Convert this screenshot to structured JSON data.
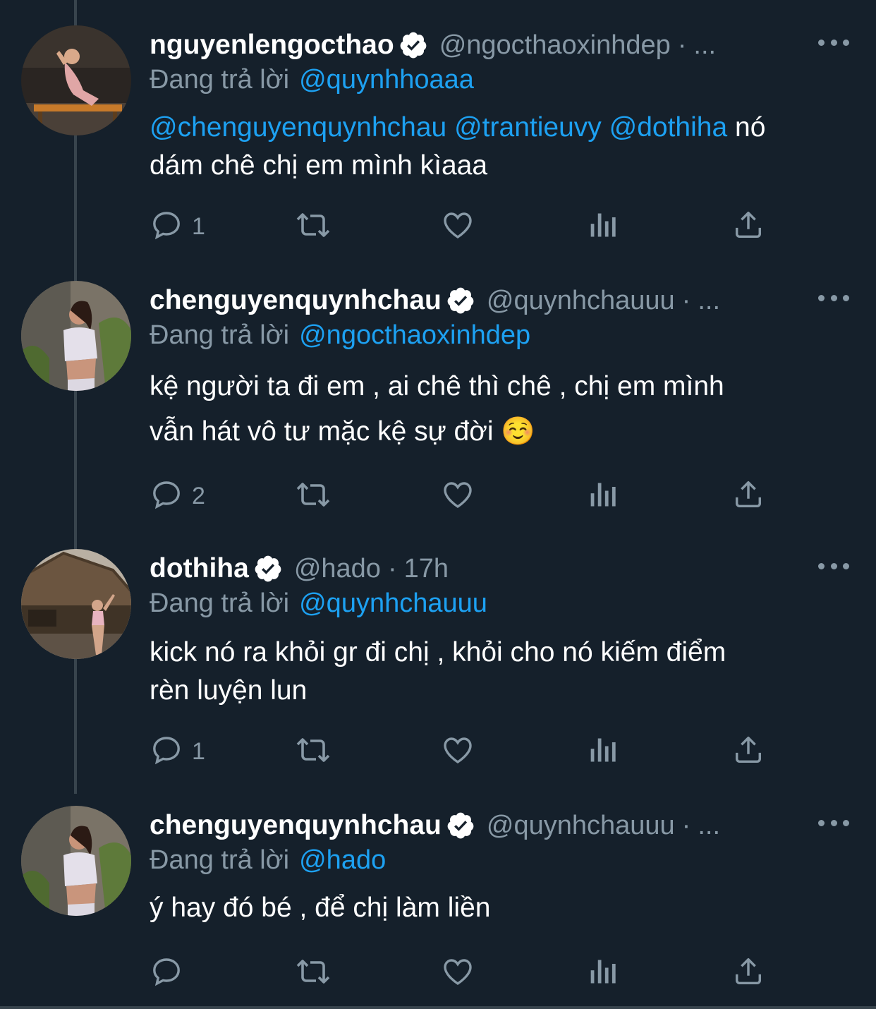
{
  "colors": {
    "background": "#15202b",
    "text": "#ffffff",
    "muted": "#8899a6",
    "accent": "#1da1f2"
  },
  "reply_prefix": "Đang trả lời",
  "tweets": [
    {
      "name": "nguyenlengocthao",
      "handle": "@ngocthaoxinhdep",
      "separator": "·",
      "time": "...",
      "reply_to": "@quynhhoaaa",
      "mentions": [
        "@chenguyenquynhchau",
        "@trantieuvy",
        "@dothiha"
      ],
      "text_after_mentions": "nó",
      "text_line2": "dám chê chị em mình kìaaa",
      "reply_count": "1"
    },
    {
      "name": "chenguyenquynhchau",
      "handle": "@quynhchauuu",
      "separator": "·",
      "time": "...",
      "reply_to": "@ngocthaoxinhdep",
      "text_line1": "kệ người ta đi em , ai chê thì chê , chị em mình",
      "text_line2": "vẫn hát vô tư mặc kệ sự đời ☺️",
      "reply_count": "2"
    },
    {
      "name": "dothiha",
      "handle": "@hado",
      "separator": "·",
      "time": "17h",
      "reply_to": "@quynhchauuu",
      "text_line1": "kick nó ra khỏi gr đi chị , khỏi cho nó kiếm điểm",
      "text_line2": "rèn luyện lun",
      "reply_count": "1"
    },
    {
      "name": "chenguyenquynhchau",
      "handle": "@quynhchauuu",
      "separator": "·",
      "time": "...",
      "reply_to": "@hado",
      "text_line1": "ý hay đó bé , để chị làm liền",
      "reply_count": ""
    }
  ]
}
